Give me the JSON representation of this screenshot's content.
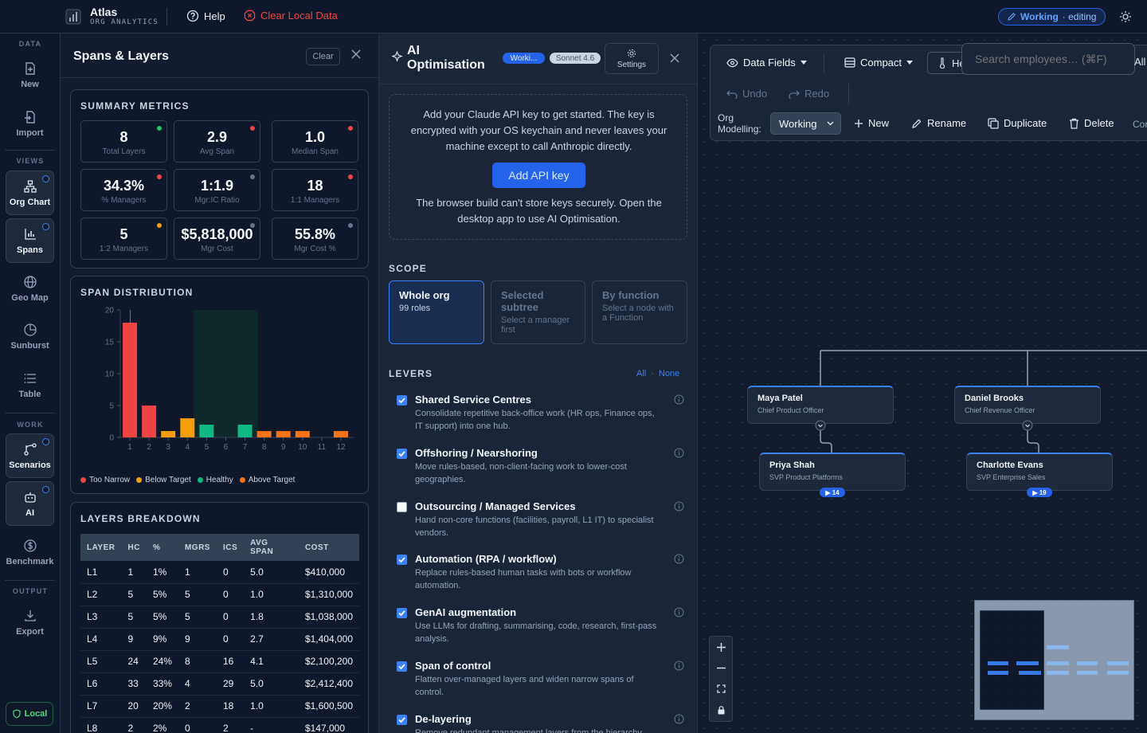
{
  "app": {
    "name": "Atlas",
    "subtitle": "ORG ANALYTICS",
    "help": "Help",
    "clear_local": "Clear Local Data",
    "mode_badge": "Working",
    "mode_state": "· editing"
  },
  "sidebar": {
    "sections": {
      "data": "DATA",
      "views": "VIEWS",
      "work": "WORK",
      "output": "OUTPUT"
    },
    "items": {
      "new": "New",
      "import": "Import",
      "org_chart": "Org Chart",
      "spans": "Spans",
      "geo_map": "Geo Map",
      "sunburst": "Sunburst",
      "table": "Table",
      "scenarios": "Scenarios",
      "ai": "AI",
      "benchmark": "Benchmark",
      "export": "Export"
    },
    "local": "Local"
  },
  "spans_panel": {
    "title": "Spans & Layers",
    "clear": "Clear",
    "summary_title": "SUMMARY METRICS",
    "metrics": [
      {
        "value": "8",
        "label": "Total Layers",
        "status": "#22c55e"
      },
      {
        "value": "2.9",
        "label": "Avg Span",
        "status": "#ef4444"
      },
      {
        "value": "1.0",
        "label": "Median Span",
        "status": "#ef4444"
      },
      {
        "value": "34.3%",
        "label": "% Managers",
        "status": "#ef4444"
      },
      {
        "value": "1:1.9",
        "label": "Mgr:IC Ratio",
        "status": "#64748b"
      },
      {
        "value": "18",
        "label": "1:1 Managers",
        "status": "#ef4444"
      },
      {
        "value": "5",
        "label": "1:2 Managers",
        "status": "#f59e0b"
      },
      {
        "value": "$5,818,000",
        "label": "Mgr Cost",
        "status": "#64748b"
      },
      {
        "value": "55.8%",
        "label": "Mgr Cost %",
        "status": "#64748b"
      }
    ],
    "distribution_title": "SPAN DISTRIBUTION",
    "legend": {
      "too_narrow": "Too Narrow",
      "below": "Below Target",
      "healthy": "Healthy",
      "above": "Above Target"
    },
    "layers_title": "LAYERS BREAKDOWN",
    "columns": [
      "LAYER",
      "HC",
      "%",
      "MGRS",
      "ICS",
      "AVG SPAN",
      "COST"
    ],
    "rows": [
      [
        "L1",
        "1",
        "1%",
        "1",
        "0",
        "5.0",
        "$410,000"
      ],
      [
        "L2",
        "5",
        "5%",
        "5",
        "0",
        "1.0",
        "$1,310,000"
      ],
      [
        "L3",
        "5",
        "5%",
        "5",
        "0",
        "1.8",
        "$1,038,000"
      ],
      [
        "L4",
        "9",
        "9%",
        "9",
        "0",
        "2.7",
        "$1,404,000"
      ],
      [
        "L5",
        "24",
        "24%",
        "8",
        "16",
        "4.1",
        "$2,100,200"
      ],
      [
        "L6",
        "33",
        "33%",
        "4",
        "29",
        "5.0",
        "$2,412,400"
      ],
      [
        "L7",
        "20",
        "20%",
        "2",
        "18",
        "1.0",
        "$1,600,500"
      ],
      [
        "L8",
        "2",
        "2%",
        "0",
        "2",
        "-",
        "$147,000"
      ]
    ]
  },
  "chart_data": {
    "type": "bar",
    "title": "SPAN DISTRIBUTION",
    "categories": [
      "1",
      "2",
      "3",
      "4",
      "5",
      "6",
      "7",
      "8",
      "9",
      "10",
      "11",
      "12"
    ],
    "values": [
      18,
      5,
      1,
      3,
      2,
      0,
      2,
      1,
      1,
      1,
      0,
      1
    ],
    "category_colors": [
      "#ef4444",
      "#ef4444",
      "#f59e0b",
      "#f59e0b",
      "#10b981",
      "#10b981",
      "#10b981",
      "#f97316",
      "#f97316",
      "#f97316",
      "#f97316",
      "#f97316"
    ],
    "ylim": [
      0,
      20
    ],
    "yticks": [
      "0",
      "5",
      "10",
      "15",
      "20"
    ],
    "healthy_band": [
      "5",
      "8"
    ],
    "legend_placement": "bottom",
    "grid": false
  },
  "ai_panel": {
    "title_line1": "AI",
    "title_line2": "Optimisation",
    "badge_working": "Worki...",
    "badge_model": "Sonnet 4.6",
    "settings": "Settings",
    "api_text": "Add your Claude API key to get started. The key is encrypted with your OS keychain and never leaves your machine except to call Anthropic directly.",
    "add_key": "Add API key",
    "browser_note": "The browser build can't store keys securely. Open the desktop app to use AI Optimisation.",
    "scope_title": "SCOPE",
    "scopes": [
      {
        "title": "Whole org",
        "desc": "99 roles"
      },
      {
        "title": "Selected subtree",
        "desc": "Select a manager first"
      },
      {
        "title": "By function",
        "desc": "Select a node with a Function"
      }
    ],
    "levers_title": "LEVERS",
    "all": "All",
    "sep": "·",
    "none": "None",
    "levers": [
      {
        "title": "Shared Service Centres",
        "desc": "Consolidate repetitive back-office work (HR ops, Finance ops, IT support) into one hub.",
        "checked": true
      },
      {
        "title": "Offshoring / Nearshoring",
        "desc": "Move rules-based, non-client-facing work to lower-cost geographies.",
        "checked": true
      },
      {
        "title": "Outsourcing / Managed Services",
        "desc": "Hand non-core functions (facilities, payroll, L1 IT) to specialist vendors.",
        "checked": false
      },
      {
        "title": "Automation (RPA / workflow)",
        "desc": "Replace rules-based human tasks with bots or workflow automation.",
        "checked": true
      },
      {
        "title": "GenAI augmentation",
        "desc": "Use LLMs for drafting, summarising, code, research, first-pass analysis.",
        "checked": true
      },
      {
        "title": "Span of control",
        "desc": "Flatten over-managed layers and widen narrow spans of control.",
        "checked": true
      },
      {
        "title": "De-layering",
        "desc": "Remove redundant management layers from the hierarchy.",
        "checked": true
      }
    ]
  },
  "canvas": {
    "data_fields": "Data Fields",
    "compact": "Compact",
    "h_label": "He",
    "search_placeholder": "Search employees… (⌘F)",
    "all_label": "All",
    "undo": "Undo",
    "redo": "Redo",
    "org_modelling": "Org Modelling:",
    "mode_select": "Working",
    "new": "New",
    "rename": "Rename",
    "duplicate": "Duplicate",
    "delete": "Delete",
    "more": "Cor",
    "nodes": [
      {
        "name": "Maya Patel",
        "role": "Chief Product Officer"
      },
      {
        "name": "Daniel Brooks",
        "role": "Chief Revenue Officer"
      },
      {
        "name": "Priya Shah",
        "role": "SVP Product Platforms",
        "count": "▶ 14"
      },
      {
        "name": "Charlotte Evans",
        "role": "SVP Enterprise Sales",
        "count": "▶ 19"
      }
    ]
  }
}
